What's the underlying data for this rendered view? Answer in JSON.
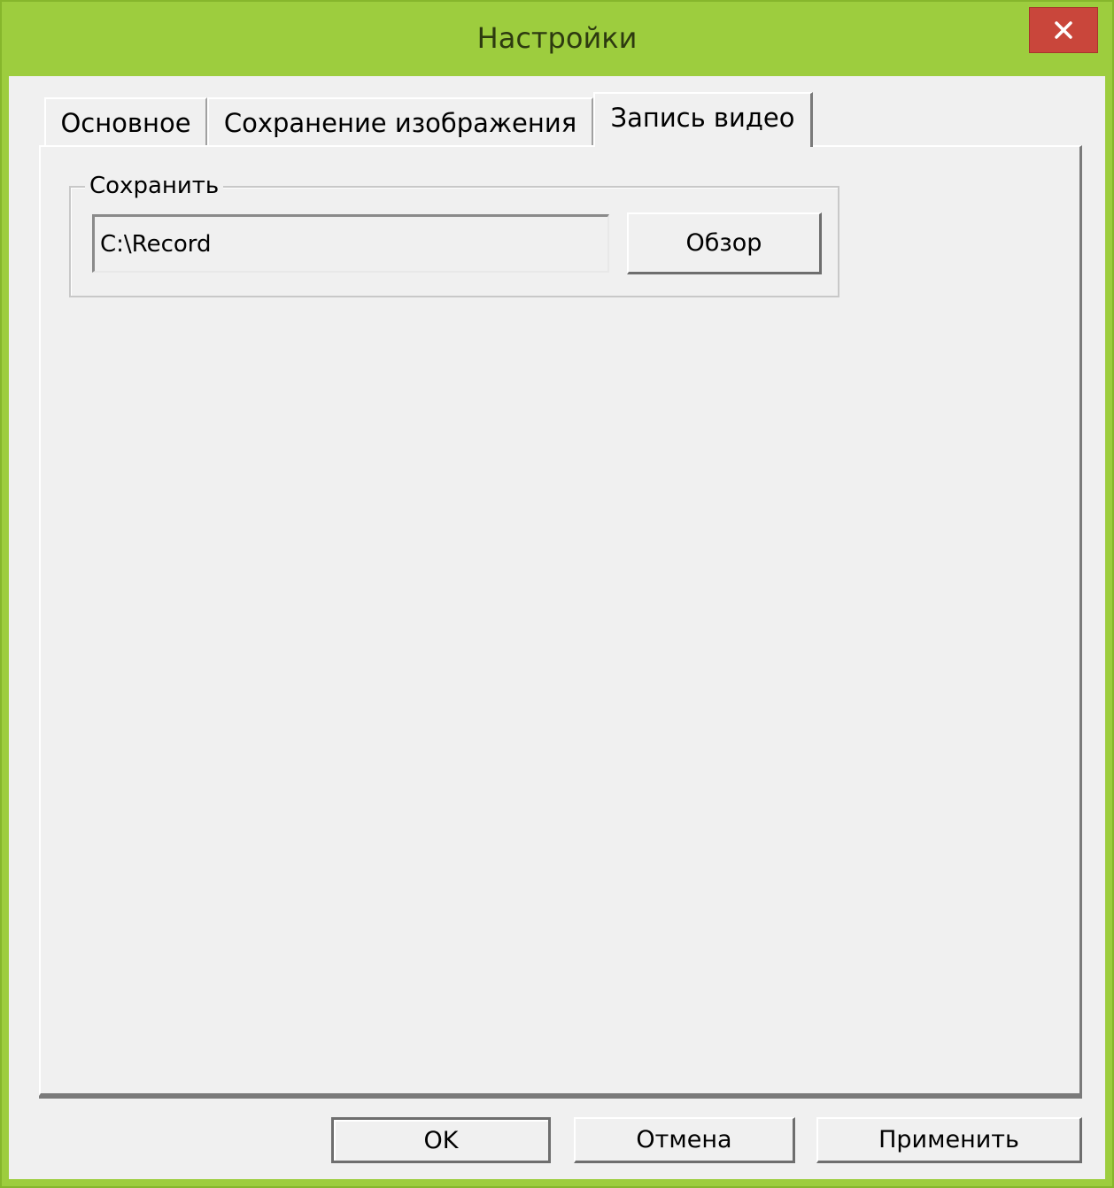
{
  "window": {
    "title": "Настройки",
    "colors": {
      "frame": "#9dcd3e",
      "close_button": "#c9463b",
      "background": "#f0f0f0"
    }
  },
  "tabs": [
    {
      "label": "Основное",
      "active": false
    },
    {
      "label": "Сохранение изображения",
      "active": false
    },
    {
      "label": "Запись видео",
      "active": true
    }
  ],
  "save_group": {
    "label": "Сохранить",
    "path_value": "C:\\Record",
    "browse_label": "Обзор"
  },
  "footer": {
    "ok_label": "OK",
    "cancel_label": "Отмена",
    "apply_label": "Применить"
  }
}
